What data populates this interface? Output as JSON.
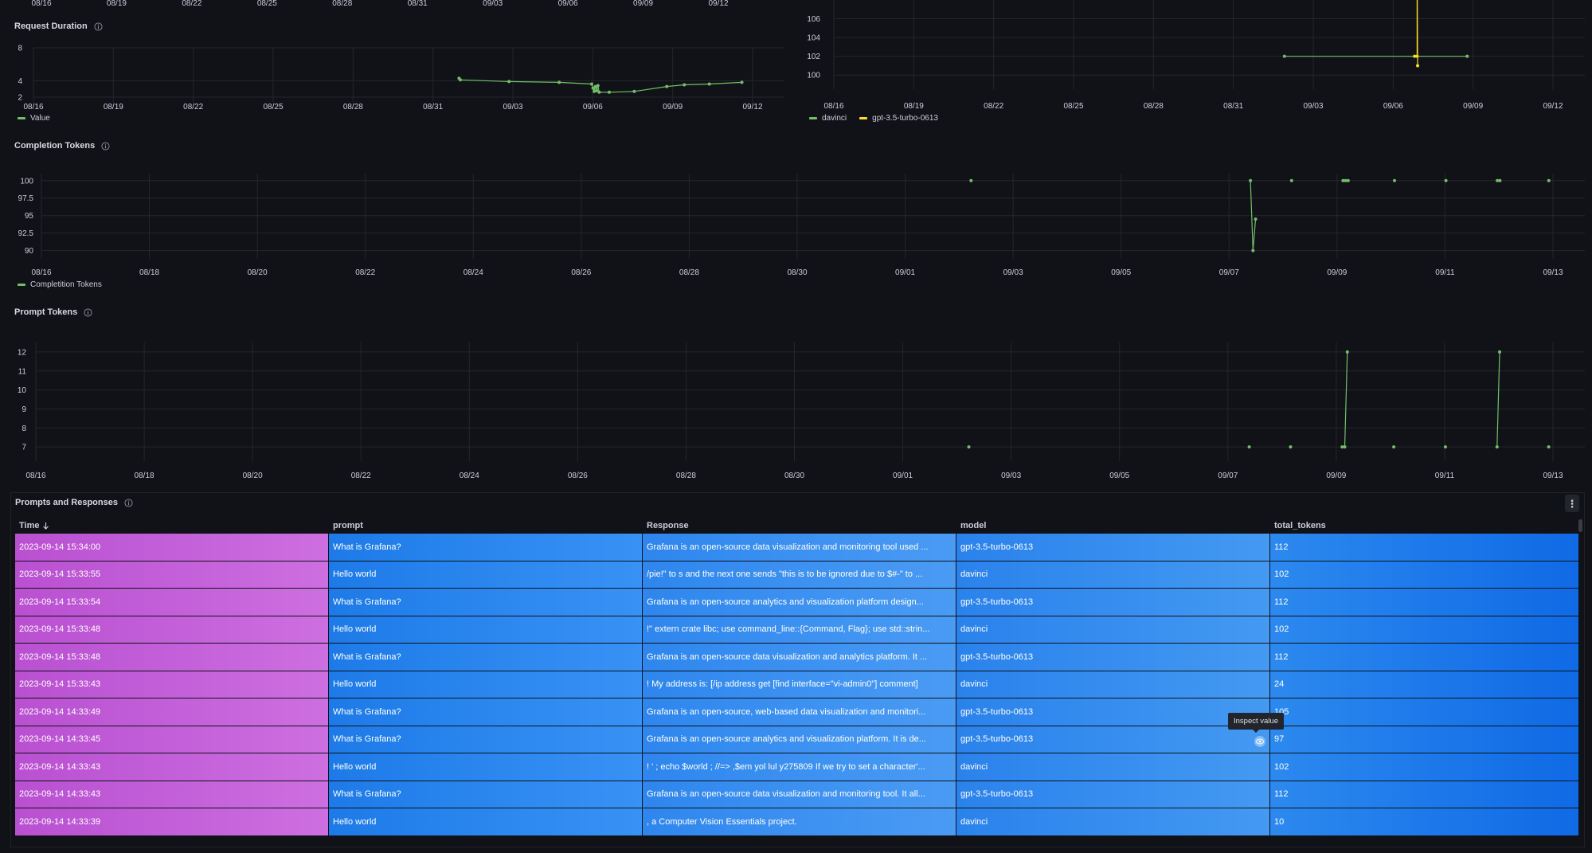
{
  "top_strip": {
    "dates": [
      "08/16",
      "08/19",
      "08/22",
      "08/25",
      "08/28",
      "08/31",
      "09/03",
      "09/06",
      "09/09",
      "09/12"
    ]
  },
  "request_duration": {
    "title": "Request Duration",
    "info_icon": "info-circle-icon",
    "legend": [
      {
        "name": "Value",
        "color": "#73bf69"
      }
    ]
  },
  "total_tokens_chart": {
    "legend": [
      {
        "name": "davinci",
        "color": "#73bf69"
      },
      {
        "name": "gpt-3.5-turbo-0613",
        "color": "#fade2a"
      }
    ]
  },
  "completion_tokens": {
    "title": "Completion Tokens",
    "info_icon": "info-circle-icon",
    "legend": [
      {
        "name": "Completition Tokens",
        "color": "#73bf69"
      }
    ]
  },
  "prompt_tokens": {
    "title": "Prompt Tokens",
    "info_icon": "info-circle-icon"
  },
  "chart_data": [
    {
      "type": "line",
      "title": "Request Duration",
      "xlabel": "",
      "ylabel": "",
      "ylim": [
        2,
        8
      ],
      "y_ticks": [
        2,
        4,
        8
      ],
      "x_ticks": [
        "08/16",
        "08/19",
        "08/22",
        "08/25",
        "08/28",
        "08/31",
        "09/03",
        "09/06",
        "09/09",
        "09/12"
      ],
      "x_domain": [
        0,
        30
      ],
      "series": [
        {
          "name": "Value",
          "color": "#73bf69",
          "x": [
            17.0,
            17.05,
            19.0,
            21.0,
            22.3,
            22.35,
            22.4,
            22.45,
            22.5,
            22.55,
            22.6,
            23.0,
            24.0,
            25.3,
            26.0,
            27.0,
            28.3
          ],
          "y": [
            4.3,
            4.1,
            3.9,
            3.8,
            3.6,
            3.1,
            2.7,
            3.3,
            2.8,
            3.4,
            2.6,
            2.6,
            2.7,
            3.3,
            3.5,
            3.6,
            3.8
          ]
        }
      ],
      "grid": true,
      "legend_position": "bottom-left"
    },
    {
      "type": "line",
      "title": "",
      "xlabel": "",
      "ylabel": "",
      "ylim": [
        99,
        108
      ],
      "y_ticks": [
        100,
        102,
        104,
        106
      ],
      "x_ticks": [
        "08/16",
        "08/19",
        "08/22",
        "08/25",
        "08/28",
        "08/31",
        "09/03",
        "09/06",
        "09/09",
        "09/12"
      ],
      "x_domain": [
        0,
        30
      ],
      "series": [
        {
          "name": "davinci",
          "color": "#73bf69",
          "x": [
            18.0,
            25.3
          ],
          "y": [
            102,
            102
          ]
        },
        {
          "name": "gpt-3.5-turbo-0613",
          "color": "#fade2a",
          "x": [
            23.2,
            23.3,
            23.3,
            23.32
          ],
          "y": [
            102,
            102,
            112,
            101
          ]
        }
      ],
      "grid": true,
      "legend_position": "bottom-left"
    },
    {
      "type": "scatter",
      "title": "Completion Tokens",
      "xlabel": "",
      "ylabel": "",
      "ylim": [
        89.5,
        101
      ],
      "y_ticks": [
        90,
        92.5,
        95,
        97.5,
        100
      ],
      "x_ticks": [
        "08/16",
        "08/18",
        "08/20",
        "08/22",
        "08/24",
        "08/26",
        "08/28",
        "08/30",
        "09/01",
        "09/03",
        "09/05",
        "09/07",
        "09/09",
        "09/11",
        "09/13"
      ],
      "x_domain": [
        0,
        30
      ],
      "series": [
        {
          "name": "Completition Tokens",
          "color": "#73bf69",
          "x": [
            18.07,
            23.5,
            23.55,
            23.6,
            24.3,
            25.3,
            25.35,
            25.4,
            26.3,
            27.3,
            28.3,
            28.35,
            29.3
          ],
          "y": [
            100,
            100,
            90,
            94.5,
            100,
            100,
            100,
            100,
            100,
            100,
            100,
            100,
            100
          ]
        }
      ],
      "grid": true,
      "legend_position": "bottom-left"
    },
    {
      "type": "scatter",
      "title": "Prompt Tokens",
      "xlabel": "",
      "ylabel": "",
      "ylim": [
        6.5,
        12.5
      ],
      "y_ticks": [
        7,
        8,
        9,
        10,
        11,
        12
      ],
      "x_ticks": [
        "08/16",
        "08/18",
        "08/20",
        "08/22",
        "08/24",
        "08/26",
        "08/28",
        "08/30",
        "09/01",
        "09/03",
        "09/05",
        "09/07",
        "09/09",
        "09/11",
        "09/13"
      ],
      "x_domain": [
        0,
        30
      ],
      "series": [
        {
          "name": "Prompt Tokens",
          "color": "#73bf69",
          "x": [
            18.07,
            23.5,
            24.3,
            25.3,
            25.35,
            25.4,
            26.3,
            27.3,
            28.3,
            28.35,
            29.3
          ],
          "y": [
            7,
            7,
            7,
            7,
            7,
            12,
            7,
            7,
            7,
            12,
            7
          ]
        }
      ],
      "grid": true
    }
  ],
  "table_panel": {
    "title": "Prompts and Responses",
    "info_icon": "info-circle-icon",
    "menu_icon": "vertical-ellipsis-icon",
    "columns": [
      "Time",
      "prompt",
      "Response",
      "model",
      "total_tokens"
    ],
    "sort_icon": "arrow-down-icon",
    "rows": [
      [
        "2023-09-14 15:34:00",
        "What is Grafana?",
        "Grafana is an open-source data visualization and monitoring tool used ...",
        "gpt-3.5-turbo-0613",
        "112"
      ],
      [
        "2023-09-14 15:33:55",
        "Hello world",
        "/pie!\" to s and the next one sends \"this is to be ignored due to $#-\" to ...",
        "davinci",
        "102"
      ],
      [
        "2023-09-14 15:33:54",
        "What is Grafana?",
        "Grafana is an open-source analytics and visualization platform design...",
        "gpt-3.5-turbo-0613",
        "112"
      ],
      [
        "2023-09-14 15:33:48",
        "Hello world",
        "!\" extern crate libc; use command_line::{Command, Flag}; use std::strin...",
        "davinci",
        "102"
      ],
      [
        "2023-09-14 15:33:48",
        "What is Grafana?",
        "Grafana is an open-source data visualization and analytics platform. It ...",
        "gpt-3.5-turbo-0613",
        "112"
      ],
      [
        "2023-09-14 15:33:43",
        "Hello world",
        "! My address is: [/ip address get [find interface=\"vi-admin0\"] comment]",
        "davinci",
        "24"
      ],
      [
        "2023-09-14 14:33:49",
        "What is Grafana?",
        "Grafana is an open-source, web-based data visualization and monitori...",
        "gpt-3.5-turbo-0613",
        "105"
      ],
      [
        "2023-09-14 14:33:45",
        "What is Grafana?",
        "Grafana is an open-source analytics and visualization platform. It is de...",
        "gpt-3.5-turbo-0613",
        "97"
      ],
      [
        "2023-09-14 14:33:43",
        "Hello world",
        "! ' ; echo $world ; //=> ,$em yol lul y275809 If we try to set a character'...",
        "davinci",
        "102"
      ],
      [
        "2023-09-14 14:33:43",
        "What is Grafana?",
        "Grafana is an open-source data visualization and monitoring tool. It all...",
        "gpt-3.5-turbo-0613",
        "112"
      ],
      [
        "2023-09-14 14:33:39",
        "Hello world",
        ", a Computer Vision Essentials project.",
        "davinci",
        "10"
      ]
    ],
    "tooltip": "Inspect value",
    "inspect_icon": "eye-icon"
  }
}
